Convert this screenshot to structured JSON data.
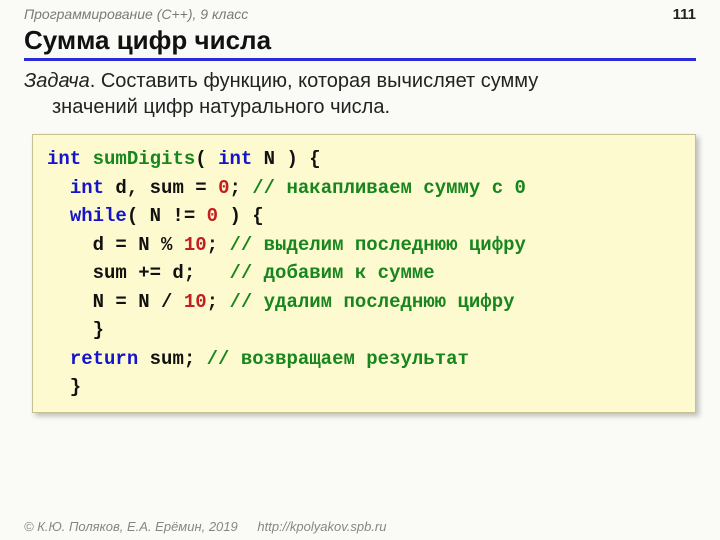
{
  "header": {
    "course": "Программирование (C++), 9 класс",
    "page": "111"
  },
  "title": "Сумма цифр числа",
  "task": {
    "label": "Задача",
    "line1": ". Составить функцию, которая вычисляет сумму",
    "line2": "значений цифр натурального числа."
  },
  "code": {
    "kw_int1": "int",
    "fn_name": "sumDigits",
    "open_paren": "( ",
    "kw_int2": "int",
    "param": " N ) {",
    "l2_indent": "  ",
    "kw_int3": "int",
    "l2_rest": " d, sum = ",
    "num_zero": "0",
    "l2_tail": "; ",
    "l2_comment": "// накапливаем сумму с 0",
    "l3_indent": "  ",
    "kw_while": "while",
    "l3_cond": "( N != ",
    "l3_zero": "0",
    "l3_tail": " ) {",
    "l4": "    d = N % ",
    "num_ten1": "10",
    "l4_tail": "; ",
    "l4_comment": "// выделим последнюю цифру",
    "l5": "    sum += d;   ",
    "l5_comment": "// добавим к сумме",
    "l6": "    N = N / ",
    "num_ten2": "10",
    "l6_tail": "; ",
    "l6_comment": "// удалим последнюю цифру",
    "l7": "    }",
    "l8_indent": "  ",
    "kw_return": "return",
    "l8_rest": " sum; ",
    "l8_comment": "// возвращаем результат",
    "l9": "  }"
  },
  "footer": {
    "copyright": "© К.Ю. Поляков, Е.А. Ерёмин, 2019",
    "url": "http://kpolyakov.spb.ru"
  }
}
